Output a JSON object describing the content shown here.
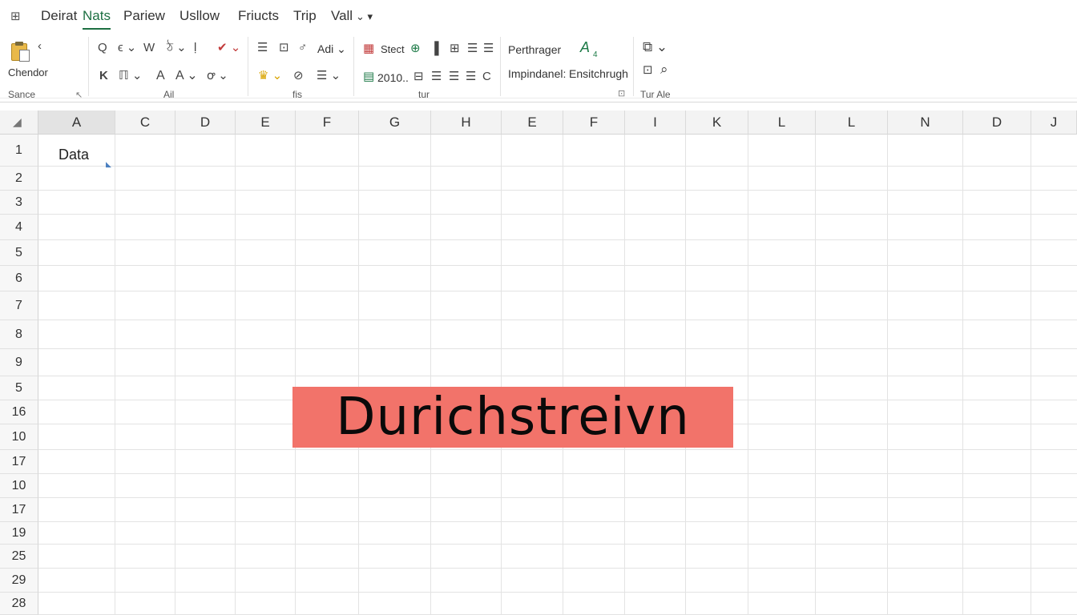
{
  "menubar": {
    "app_icon": "sheet-grid-icon",
    "tabs": [
      "Deirat",
      "Nats",
      "Pariew",
      "Usllow",
      "Friucts",
      "Trip",
      "Vall"
    ],
    "active_tab": "Nats",
    "overflow": "⌄ ▾"
  },
  "ribbon": {
    "clipboard": {
      "label": "Chendor",
      "group": "Sance",
      "icon": "paste-clipboard-icon",
      "arrow": "‹",
      "launcher": "↖"
    },
    "font": {
      "group": "Ail",
      "row1": [
        "Q",
        "ϵ ⌄",
        "W",
        "ঠ ⌄",
        "ḷ",
        "✔ ⌄"
      ],
      "row2": [
        "K",
        "ℿ ⌄",
        "A",
        "A ⌄",
        "ꝍ ⌄"
      ],
      "adi": "Adi ⌄"
    },
    "align": {
      "group": "fis",
      "row1": [
        "☰",
        "⊡",
        "♂"
      ],
      "row2": [
        "♛ ⌄",
        "⊘",
        "☰ ⌄"
      ]
    },
    "number": {
      "group": "tur",
      "stect": "Stect",
      "year": "2010..",
      "row1_icons": [
        "▦",
        "⊕",
        "▐",
        "⊞",
        "☰",
        "☰"
      ],
      "row2_icons": [
        "▤",
        "⊟",
        "☰",
        "☰",
        "C"
      ]
    },
    "styles": {
      "perthrager": "Perthrager",
      "a_badge": "A",
      "a_sub": "4",
      "impindanel": "Impindanel:",
      "ensitchrugh": "Ensitchrugh",
      "launcher": "⊡"
    },
    "cells": {
      "group": "Tur Ale",
      "icons": [
        "⧉ ⌄",
        "⊡",
        "⌕"
      ]
    }
  },
  "grid": {
    "columns": [
      "A",
      "C",
      "D",
      "E",
      "F",
      "G",
      "H",
      "E",
      "F",
      "I",
      "K",
      "L",
      "L",
      "N",
      "D",
      "J"
    ],
    "selected_column": "A",
    "rows": [
      "1",
      "2",
      "3",
      "4",
      "5",
      "6",
      "7",
      "8",
      "9",
      "5",
      "16",
      "10",
      "17",
      "10",
      "17",
      "19",
      "25",
      "29",
      "28"
    ],
    "cell_a1": "Data",
    "fill_handle_mark": "◣"
  },
  "overlay": {
    "text": "Durichstreivn",
    "bg_color": "#f2736a"
  },
  "colors": {
    "accent": "#1d6f42",
    "header_bg": "#f3f3f3",
    "gridline": "#e3e3e3"
  }
}
